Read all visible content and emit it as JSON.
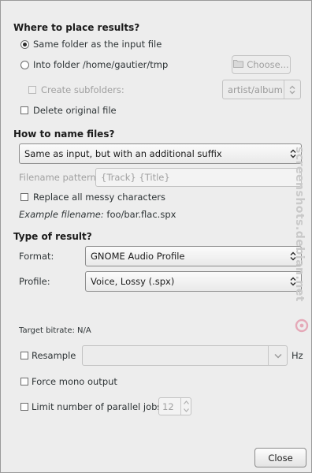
{
  "placement": {
    "title": "Where to place results?",
    "same_folder_label": "Same folder as the input file",
    "into_folder_label": "Into folder /home/gautier/tmp",
    "choose_label": "Choose...",
    "create_subfolders_label": "Create subfolders:",
    "subfolder_value": "artist/album",
    "delete_original_label": "Delete original file"
  },
  "naming": {
    "title": "How to name files?",
    "scheme_value": "Same as input, but with an additional suffix",
    "pattern_label": "Filename pattern:",
    "pattern_value": "{Track} {Title}",
    "replace_messy_label": "Replace all messy characters",
    "example_prefix": "Example filename:",
    "example_value": "foo/bar.flac.spx"
  },
  "result": {
    "title": "Type of result?",
    "format_label": "Format:",
    "format_value": "GNOME Audio Profile",
    "profile_label": "Profile:",
    "profile_value": "Voice, Lossy (.spx)",
    "bitrate_text": "Target bitrate: N/A",
    "resample_label": "Resample",
    "resample_value": "",
    "hz_label": "Hz",
    "force_mono_label": "Force mono output",
    "limit_jobs_label": "Limit number of parallel jobs",
    "jobs_value": "12"
  },
  "footer": {
    "close_label": "Close"
  },
  "watermark": {
    "text": "screenshots.debian.net"
  }
}
